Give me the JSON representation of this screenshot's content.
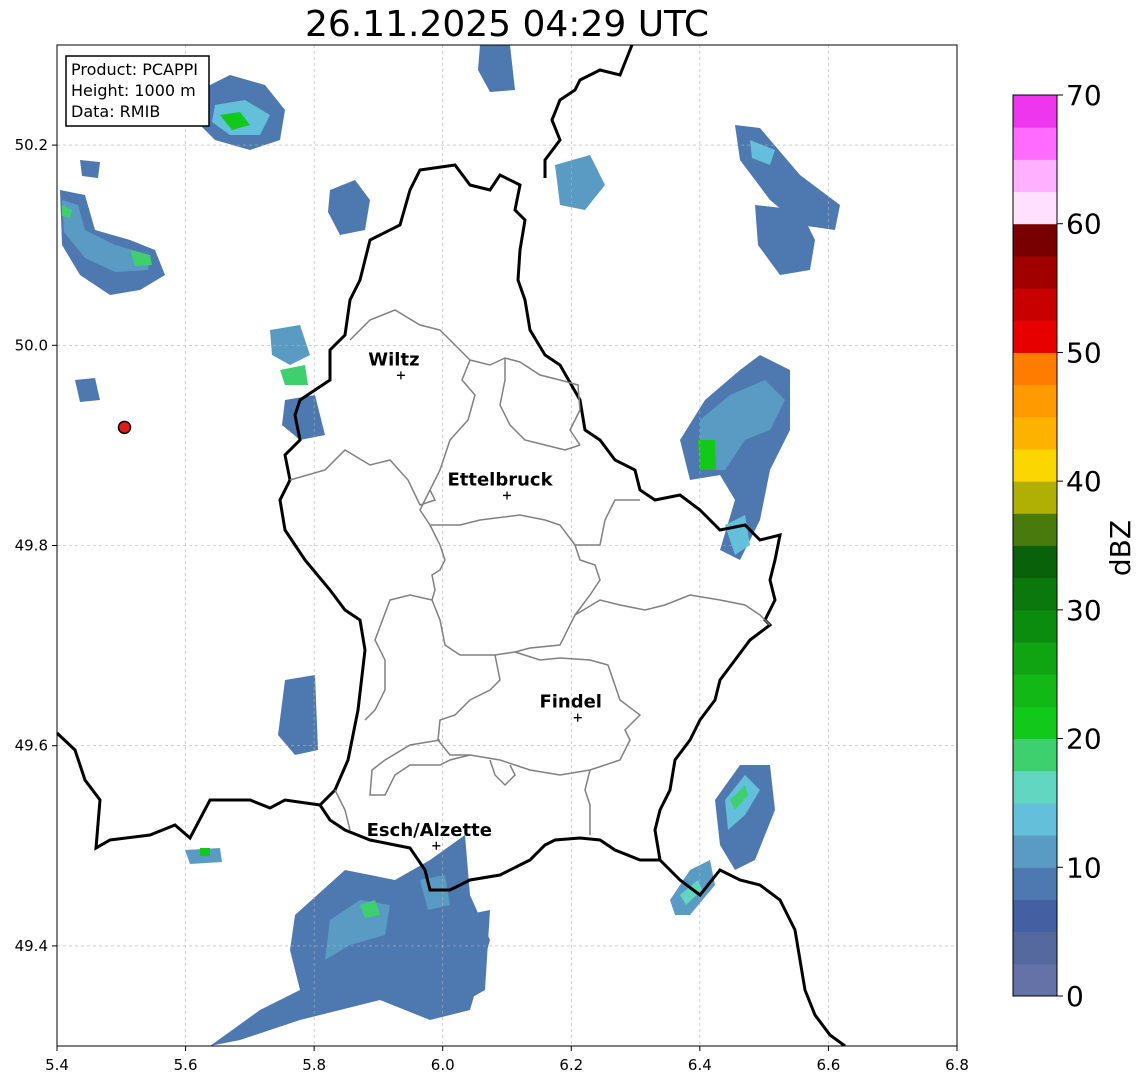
{
  "title": "26.11.2025 04:29 UTC",
  "info_box": {
    "product": "Product: PCAPPI",
    "height": "Height: 1000 m",
    "data": "Data: RMIB"
  },
  "colorbar": {
    "label": "dBZ",
    "ticks": [
      "0",
      "10",
      "20",
      "30",
      "40",
      "50",
      "60",
      "70"
    ],
    "levels": [
      {
        "from": 0,
        "to": 2.5,
        "color": "#6472a8"
      },
      {
        "from": 2.5,
        "to": 5,
        "color": "#55699f"
      },
      {
        "from": 5,
        "to": 7.5,
        "color": "#4460a3"
      },
      {
        "from": 7.5,
        "to": 10,
        "color": "#4d79b0"
      },
      {
        "from": 10,
        "to": 12.5,
        "color": "#5a9bc4"
      },
      {
        "from": 12.5,
        "to": 15,
        "color": "#64bfdb"
      },
      {
        "from": 15,
        "to": 17.5,
        "color": "#62d6c1"
      },
      {
        "from": 17.5,
        "to": 20,
        "color": "#3ed06f"
      },
      {
        "from": 20,
        "to": 22.5,
        "color": "#12c81a"
      },
      {
        "from": 22.5,
        "to": 25,
        "color": "#12b816"
      },
      {
        "from": 25,
        "to": 27.5,
        "color": "#10a412"
      },
      {
        "from": 27.5,
        "to": 30,
        "color": "#0c8c0e"
      },
      {
        "from": 30,
        "to": 32.5,
        "color": "#0a780c"
      },
      {
        "from": 32.5,
        "to": 35,
        "color": "#09620a"
      },
      {
        "from": 35,
        "to": 37.5,
        "color": "#487a0e"
      },
      {
        "from": 37.5,
        "to": 40,
        "color": "#b0b004"
      },
      {
        "from": 40,
        "to": 42.5,
        "color": "#fbd600"
      },
      {
        "from": 42.5,
        "to": 45,
        "color": "#fdb200"
      },
      {
        "from": 45,
        "to": 47.5,
        "color": "#ff9a00"
      },
      {
        "from": 47.5,
        "to": 50,
        "color": "#ff7c00"
      },
      {
        "from": 50,
        "to": 52.5,
        "color": "#e60000"
      },
      {
        "from": 52.5,
        "to": 55,
        "color": "#c80000"
      },
      {
        "from": 55,
        "to": 57.5,
        "color": "#a00000"
      },
      {
        "from": 57.5,
        "to": 60,
        "color": "#780000"
      },
      {
        "from": 60,
        "to": 62.5,
        "color": "#ffe0ff"
      },
      {
        "from": 62.5,
        "to": 65,
        "color": "#ffb0ff"
      },
      {
        "from": 65,
        "to": 67.5,
        "color": "#ff6aff"
      },
      {
        "from": 67.5,
        "to": 70,
        "color": "#ee36ee"
      }
    ]
  },
  "axes": {
    "x_ticks": [
      "5.4",
      "5.6",
      "5.8",
      "6.0",
      "6.2",
      "6.4",
      "6.6",
      "6.8"
    ],
    "y_ticks": [
      "49.4",
      "49.6",
      "49.8",
      "50.0",
      "50.2"
    ],
    "lon_range": [
      5.4,
      6.8
    ],
    "lat_range": [
      49.3,
      50.3
    ],
    "grid": true
  },
  "cities": [
    {
      "name": "Wiltz",
      "lon": 5.935,
      "lat": 49.97
    },
    {
      "name": "Ettelbruck",
      "lon": 6.1,
      "lat": 49.85
    },
    {
      "name": "Findel",
      "lon": 6.21,
      "lat": 49.628
    },
    {
      "name": "Esch/Alzette",
      "lon": 5.99,
      "lat": 49.5
    }
  ],
  "radar_site": {
    "lon": 5.505,
    "lat": 49.918,
    "color": "#e01b1b"
  },
  "colors": {
    "border": "#000000",
    "canton": "#808080",
    "grid": "#b0b0b0"
  }
}
